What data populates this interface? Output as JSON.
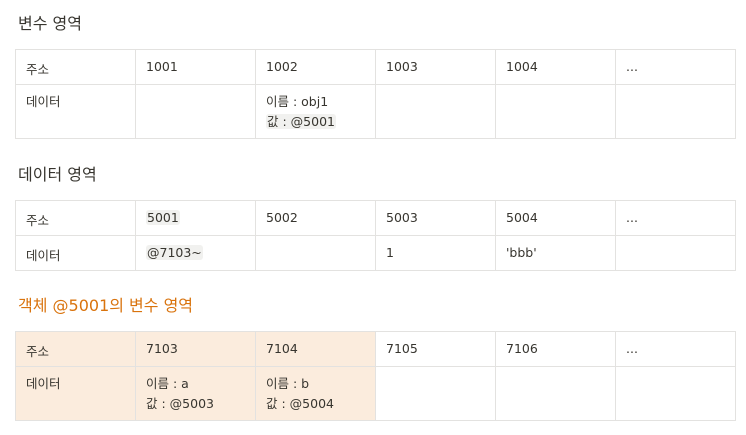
{
  "sections": [
    {
      "title": "변수 영역",
      "address_row": [
        "주소",
        "1001",
        "1002",
        "1003",
        "1004",
        "..."
      ],
      "data_row": [
        [
          "데이터"
        ],
        [],
        [
          "이름 : obj1",
          "값 : @5001"
        ],
        [],
        [],
        []
      ]
    },
    {
      "title": "데이터 영역",
      "address_row": [
        "주소",
        "5001",
        "5002",
        "5003",
        "5004",
        "..."
      ],
      "data_row": [
        [
          "데이터"
        ],
        [
          "@7103~"
        ],
        [],
        [
          "1"
        ],
        [
          "'bbb'"
        ],
        []
      ]
    },
    {
      "title": "객체 @5001의 변수 영역",
      "title_color": "#d9730d",
      "highlight_color": "#fbecdd",
      "address_row": [
        "주소",
        "7103",
        "7104",
        "7105",
        "7106",
        "..."
      ],
      "data_row": [
        [
          "데이터"
        ],
        [
          "이름 : a",
          "값 : @5003"
        ],
        [
          "이름 : b",
          "값 : @5004"
        ],
        [],
        [],
        []
      ]
    }
  ]
}
